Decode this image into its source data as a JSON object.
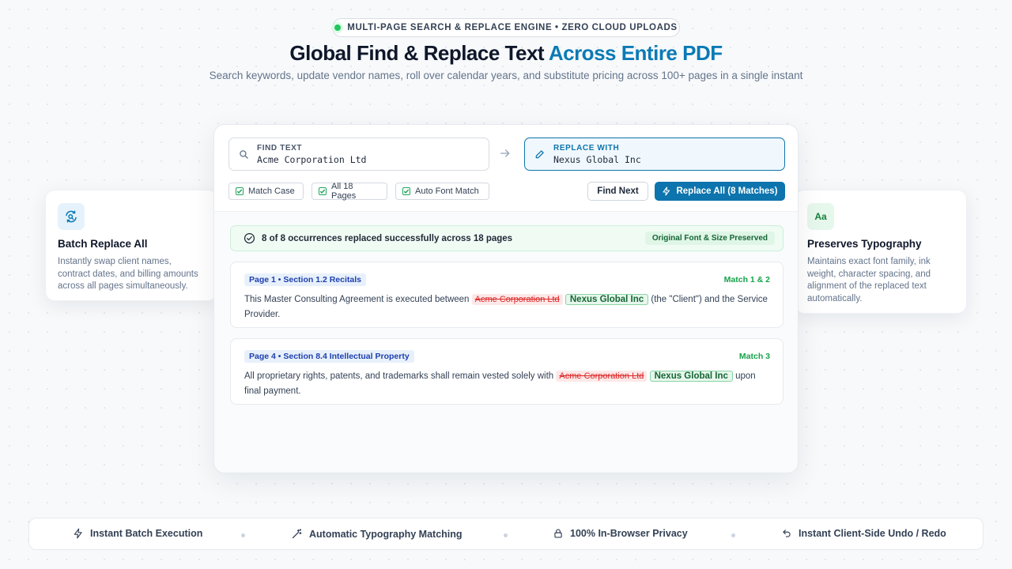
{
  "header": {
    "badge": "MULTI-PAGE SEARCH & REPLACE ENGINE • ZERO CLOUD UPLOADS",
    "title_main": "Global Find & Replace Text",
    "title_accent": "Across Entire PDF",
    "subtitle": "Search keywords, update vendor names, roll over calendar years, and substitute pricing across 100+ pages in a single instant"
  },
  "left_card": {
    "icon": "refresh-search-icon",
    "title": "Batch Replace All",
    "description": "Instantly swap client names, contract dates, and billing amounts across all pages simultaneously."
  },
  "right_card": {
    "icon": "typography-icon",
    "icon_text": "Aa",
    "title": "Preserves Typography",
    "description": "Maintains exact font family, ink weight, character spacing, and alignment of the replaced text automatically."
  },
  "find": {
    "label": "FIND TEXT",
    "value": "Acme Corporation Ltd"
  },
  "replace": {
    "label": "REPLACE WITH",
    "value": "Nexus Global Inc"
  },
  "options": [
    {
      "label": "Match Case",
      "checked": true
    },
    {
      "label": "All 18 Pages",
      "checked": true
    },
    {
      "label": "Auto Font Match",
      "checked": true
    }
  ],
  "buttons": {
    "find_next": "Find Next",
    "replace_all": "Replace All (8 Matches)"
  },
  "status": {
    "message": "8 of 8 occurrences replaced successfully across 18 pages",
    "badge": "Original Font & Size Preserved"
  },
  "matches": [
    {
      "section": "Page 1 • Section 1.2 Recitals",
      "label": "Match 1 & 2",
      "before": "This Master Consulting Agreement is executed between",
      "old": "Acme Corporation Ltd",
      "new": "Nexus Global Inc",
      "after": "(the \"Client\") and the Service Provider."
    },
    {
      "section": "Page 4 • Section 8.4 Intellectual Property",
      "label": "Match 3",
      "before": "All proprietary rights, patents, and trademarks shall remain vested solely with",
      "old": "Acme Corporation Ltd",
      "new": "Nexus Global Inc",
      "after": "upon final payment."
    }
  ],
  "footer": [
    {
      "icon": "lightning-icon",
      "label": "Instant Batch Execution"
    },
    {
      "icon": "magic-wand-icon",
      "label": "Automatic Typography Matching"
    },
    {
      "icon": "lock-icon",
      "label": "100% In-Browser Privacy"
    },
    {
      "icon": "undo-icon",
      "label": "Instant Client-Side Undo / Redo"
    }
  ],
  "colors": {
    "accent": "#0b7ab5",
    "primary_button": "#0d74ad",
    "success": "#16a34a",
    "danger": "#dc2626"
  }
}
